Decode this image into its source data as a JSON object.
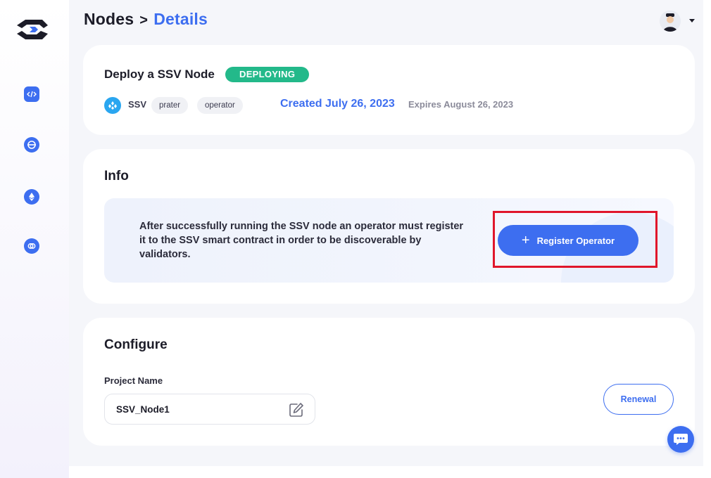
{
  "breadcrumb": {
    "root": "Nodes",
    "separator": ">",
    "current": "Details"
  },
  "sidebar": {
    "items": [
      {
        "icon": "code-icon"
      },
      {
        "icon": "network-icon"
      },
      {
        "icon": "ethereum-icon"
      },
      {
        "icon": "link-icon"
      }
    ]
  },
  "node": {
    "title": "Deploy a SSV Node",
    "status": "DEPLOYING",
    "protocol": "SSV",
    "tags": [
      "prater",
      "operator"
    ],
    "created": "Created July 26, 2023",
    "expires": "Expires August 26, 2023"
  },
  "info": {
    "title": "Info",
    "text": "After successfully running the SSV node an operator must register it to the SSV smart contract in order to be discoverable by validators.",
    "button_icon": "+",
    "button_label": "Register Operator"
  },
  "configure": {
    "title": "Configure",
    "project_name_label": "Project Name",
    "project_name_value": "SSV_Node1",
    "renewal_label": "Renewal"
  },
  "colors": {
    "accent": "#3d6ef0",
    "status_green": "#23b98a",
    "highlight": "#e0162b",
    "protocol": "#2aa6f0"
  }
}
